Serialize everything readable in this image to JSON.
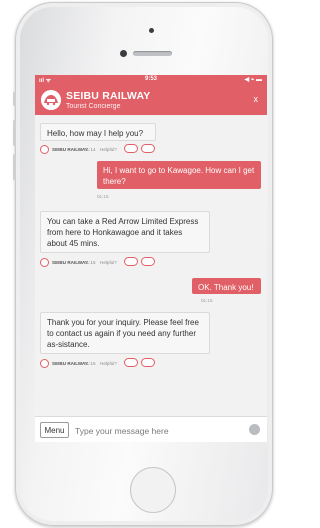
{
  "status_bar": {
    "time": "9:53",
    "signal": "ııl ᯤ",
    "right_icons": "◀ ⌁ ▬"
  },
  "header": {
    "title": "SEIBU RAILWAY",
    "subtitle": "Tourist Concierge",
    "close": "x"
  },
  "messages": [
    {
      "from": "bot",
      "text": "Hello, how may I help you?",
      "sender": "SEIBU RAILWAY",
      "time": "01:14",
      "helpful": "Helpful?"
    },
    {
      "from": "user",
      "text": "Hi, I want to go to Kawagoe. How can I get there?",
      "time": "01:15"
    },
    {
      "from": "bot",
      "text": "You can take a Red Arrow Limited Express from here to Honkawagoe and it takes about 45 mins.",
      "sender": "SEIBU RAILWAY",
      "time": "01:15",
      "helpful": "Helpful?"
    },
    {
      "from": "user",
      "text": "OK. Thank you!",
      "time": "01:15"
    },
    {
      "from": "bot",
      "text": "Thank you for your inquiry. Please feel free to contact us again if you need any further as-sistance.",
      "sender": "SEIBU RAILWAY",
      "time": "01:15",
      "helpful": "Helpful?"
    }
  ],
  "input_bar": {
    "menu_label": "Menu",
    "placeholder": "Type your message here"
  },
  "colors": {
    "brand": "#e15f66",
    "chat_bg": "#f2f2f2"
  },
  "icons": {
    "thumb_up": "thumbs-up-icon",
    "thumb_down": "thumbs-down-icon",
    "send": "send-icon"
  }
}
